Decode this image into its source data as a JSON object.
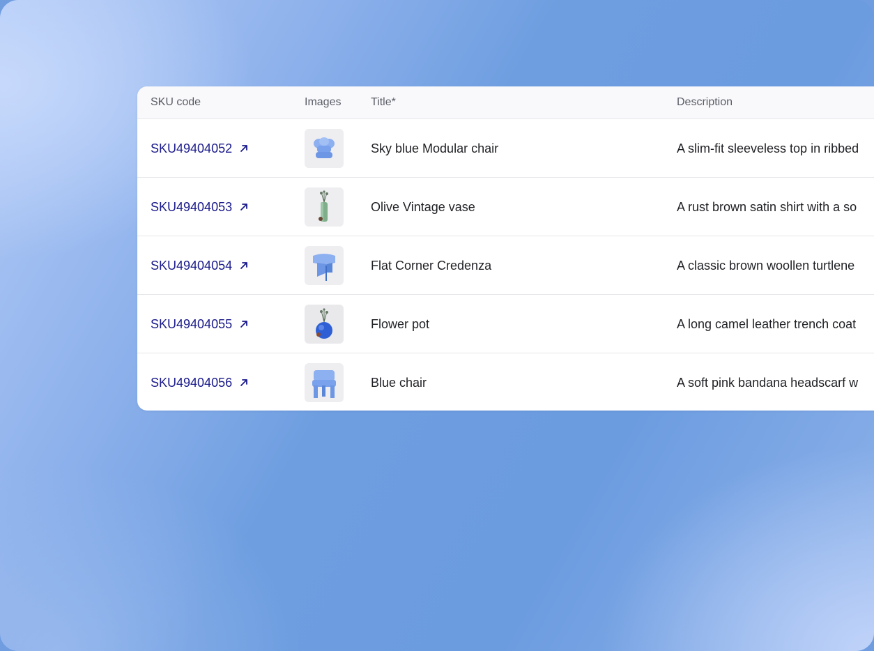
{
  "table": {
    "headers": {
      "sku": "SKU code",
      "images": "Images",
      "title": "Title*",
      "description": "Description"
    },
    "rows": [
      {
        "sku": "SKU49404052",
        "image": "modular-chair-thumbnail",
        "title": "Sky blue Modular chair",
        "description": "A slim-fit sleeveless top in ribbed"
      },
      {
        "sku": "SKU49404053",
        "image": "vintage-vase-thumbnail",
        "title": "Olive Vintage vase",
        "description": "A rust brown satin shirt with a so"
      },
      {
        "sku": "SKU49404054",
        "image": "credenza-thumbnail",
        "title": "Flat Corner Credenza",
        "description": "A classic brown woollen turtlene"
      },
      {
        "sku": "SKU49404055",
        "image": "flower-pot-thumbnail",
        "title": "Flower pot",
        "description": "A long camel leather trench coat"
      },
      {
        "sku": "SKU49404056",
        "image": "blue-chair-thumbnail",
        "title": "Blue chair",
        "description": "A soft pink bandana headscarf w"
      }
    ]
  },
  "colors": {
    "link": "#1a1a8c",
    "header_bg": "#f9f9fb",
    "product_blue": "#7aa2ec"
  }
}
